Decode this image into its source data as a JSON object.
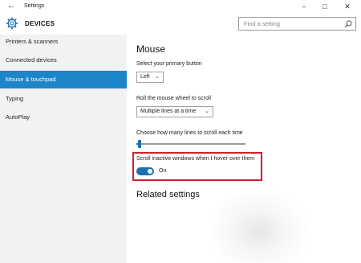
{
  "window": {
    "title": "Settings",
    "back_icon": "back-arrow-icon",
    "controls": [
      "minimize-icon",
      "maximize-icon",
      "close-icon"
    ]
  },
  "header": {
    "icon": "gear-icon",
    "title": "DEVICES"
  },
  "search": {
    "placeholder": "Find a setting",
    "icon": "search-icon"
  },
  "sidebar": {
    "items": [
      {
        "label": "Printers & scanners",
        "active": false
      },
      {
        "label": "Connected devices",
        "active": false
      },
      {
        "label": "Mouse & touchpad",
        "active": true
      },
      {
        "label": "Typing",
        "active": false
      },
      {
        "label": "AutoPlay",
        "active": false
      }
    ]
  },
  "main": {
    "section_title": "Mouse",
    "primary_button": {
      "label": "Select your primary button",
      "value": "Left"
    },
    "scroll_wheel": {
      "label": "Roll the mouse wheel to scroll",
      "value": "Multiple lines at a time"
    },
    "lines_to_scroll": {
      "label": "Choose how many lines to scroll each time",
      "level": 0.03
    },
    "inactive_scroll": {
      "label": "Scroll inactive windows when I hover over them",
      "state_label": "On",
      "on": true
    },
    "related_title": "Related settings"
  },
  "colors": {
    "accent": "#1c6fb0",
    "sidebar_active": "#1c86c8",
    "highlight_border": "#d0202a",
    "sidebar_bg": "#f2f2f2"
  }
}
